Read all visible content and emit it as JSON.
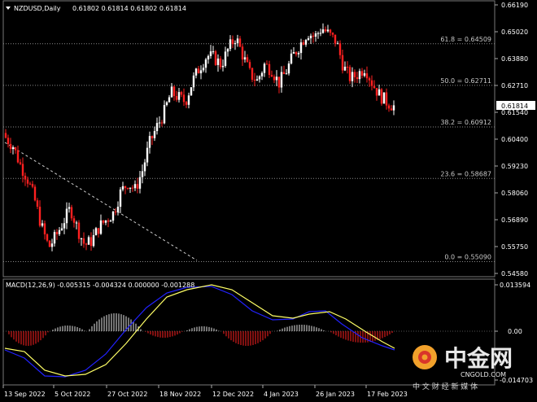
{
  "window": {
    "symbol_label": "NZDUSD,Daily",
    "ohlc_label": "0.61802 0.61814 0.61802 0.61814"
  },
  "price_axis": {
    "ticks": [
      "0.66190",
      "0.65020",
      "0.63880",
      "0.62710",
      "0.61540",
      "0.60400",
      "0.59230",
      "0.58060",
      "0.56890",
      "0.55750",
      "0.54580"
    ],
    "current_price": "0.61814"
  },
  "fib_levels": [
    {
      "label": "61.8 = 0.64509",
      "value": 0.64509
    },
    {
      "label": "50.0 = 0.62711",
      "value": 0.62711
    },
    {
      "label": "38.2 = 0.60912",
      "value": 0.60912
    },
    {
      "label": "23.6 = 0.58687",
      "value": 0.58687
    },
    {
      "label": "0.0 = 0.55090",
      "value": 0.5509
    }
  ],
  "macd": {
    "label": "MACD(12,26,9) -0.005315 -0.004324 0.000000 -0.001288",
    "ticks": [
      "0.013594",
      "0.00",
      "-0.014703"
    ]
  },
  "time_axis": [
    "13 Sep 2022",
    "5 Oct 2022",
    "27 Oct 2022",
    "18 Nov 2022",
    "12 Dec 2022",
    "4 Jan 2023",
    "26 Jan 2023",
    "17 Feb 2023"
  ],
  "watermark": {
    "brand": "中金网",
    "url": "CNGOLD.COM",
    "tagline": "中 文 财 经 新 媒 体"
  },
  "colors": {
    "bull": "#ffffff",
    "bear": "#ff2020",
    "macd_line": "#2222ff",
    "signal_line": "#ffff66",
    "grid": "#777777"
  },
  "chart_data": {
    "type": "candlestick",
    "title": "NZDUSD,Daily",
    "ylim": [
      0.5458,
      0.6619
    ],
    "close_path": [
      0.6045,
      0.601,
      0.593,
      0.587,
      0.578,
      0.566,
      0.557,
      0.562,
      0.568,
      0.574,
      0.565,
      0.558,
      0.56,
      0.566,
      0.569,
      0.572,
      0.581,
      0.585,
      0.582,
      0.59,
      0.602,
      0.609,
      0.615,
      0.624,
      0.622,
      0.62,
      0.629,
      0.635,
      0.64,
      0.639,
      0.636,
      0.643,
      0.648,
      0.64,
      0.632,
      0.629,
      0.636,
      0.634,
      0.628,
      0.633,
      0.64,
      0.645,
      0.65,
      0.648,
      0.652,
      0.649,
      0.646,
      0.635,
      0.63,
      0.632,
      0.635,
      0.628,
      0.623,
      0.62,
      0.6181
    ]
  }
}
